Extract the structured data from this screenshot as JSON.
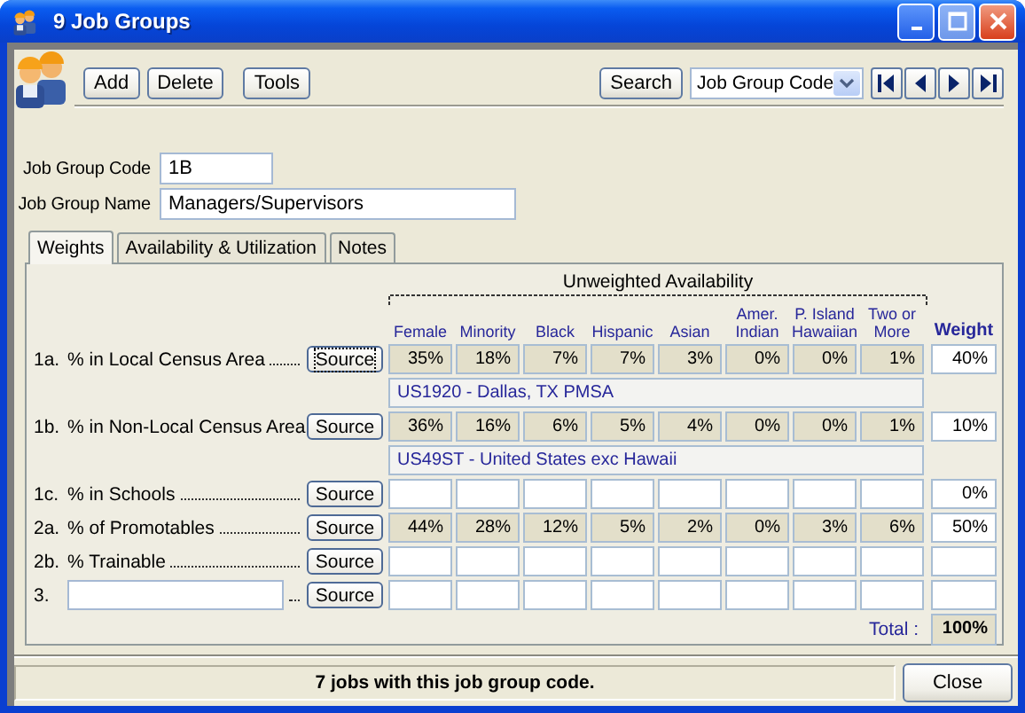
{
  "window": {
    "title": "9 Job Groups"
  },
  "toolbar": {
    "buttons": [
      "Add",
      "Delete",
      "Tools"
    ],
    "search_button": "Search",
    "search_field": {
      "value": "Job Group Code"
    }
  },
  "fields": [
    {
      "label": "Job Group Code",
      "value": "1B"
    },
    {
      "label": "Job Group Name",
      "value": "Managers/Supervisors"
    }
  ],
  "tabs": [
    {
      "label": "Weights",
      "selected": true
    },
    {
      "label": "Availability & Utilization",
      "selected": false
    },
    {
      "label": "Notes",
      "selected": false
    }
  ],
  "weights": {
    "title": "Unweighted Availability",
    "columns": [
      "Female",
      "Minority",
      "Black",
      "Hispanic",
      "Asian",
      "Amer. Indian",
      "P. Island Hawaiian",
      "Two or More"
    ],
    "weight_header": "Weight",
    "rows": [
      {
        "kind": "label",
        "number": "1a.",
        "label": "% in Local Census Area",
        "source": "Source",
        "focused": true,
        "values": [
          "35%",
          "18%",
          "7%",
          "7%",
          "3%",
          "0%",
          "0%",
          "1%"
        ],
        "weight": "40%",
        "area": "US1920 - Dallas, TX PMSA"
      },
      {
        "kind": "label",
        "number": "1b.",
        "label": "% in Non-Local Census Area",
        "source": "Source",
        "focused": false,
        "values": [
          "36%",
          "16%",
          "6%",
          "5%",
          "4%",
          "0%",
          "0%",
          "1%"
        ],
        "weight": "10%",
        "area": "US49ST - United States exc Hawaii"
      },
      {
        "kind": "label",
        "number": "1c.",
        "label": "% in Schools",
        "source": "Source",
        "focused": false,
        "weight": "0%"
      },
      {
        "kind": "label",
        "number": "2a.",
        "label": "% of Promotables",
        "source": "Source",
        "focused": false,
        "values": [
          "44%",
          "28%",
          "12%",
          "5%",
          "2%",
          "0%",
          "3%",
          "6%"
        ],
        "weight": "50%"
      },
      {
        "kind": "label",
        "number": "2b.",
        "label": "% Trainable",
        "source": "Source",
        "focused": false
      },
      {
        "kind": "input",
        "number": "3.",
        "source": "Source",
        "focused": false
      }
    ],
    "total_label": "Total :",
    "total": "100%"
  },
  "status_bar": {
    "text": "7 jobs with this job group code.",
    "close": "Close"
  }
}
